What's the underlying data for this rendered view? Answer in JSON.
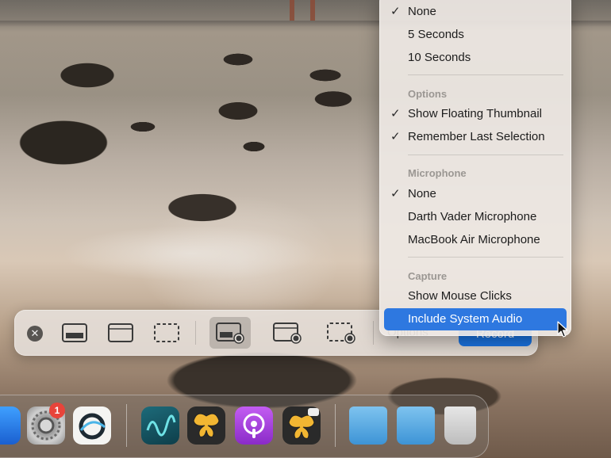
{
  "menu": {
    "timer_items": [
      {
        "label": "None",
        "checked": true
      },
      {
        "label": "5 Seconds",
        "checked": false
      },
      {
        "label": "10 Seconds",
        "checked": false
      }
    ],
    "options_header": "Options",
    "options_items": [
      {
        "label": "Show Floating Thumbnail",
        "checked": true
      },
      {
        "label": "Remember Last Selection",
        "checked": true
      }
    ],
    "microphone_header": "Microphone",
    "microphone_items": [
      {
        "label": "None",
        "checked": true
      },
      {
        "label": "Darth Vader Microphone",
        "checked": false
      },
      {
        "label": "MacBook Air Microphone",
        "checked": false
      }
    ],
    "capture_header": "Capture",
    "capture_items": [
      {
        "label": "Show Mouse Clicks",
        "checked": false
      },
      {
        "label": "Include System Audio",
        "checked": false,
        "highlighted": true
      }
    ],
    "check_glyph": "✓"
  },
  "toolbar": {
    "close_glyph": "✕",
    "options_label": "Options",
    "record_label": "Record",
    "selected_tool": "record-entire-screen"
  },
  "dock": {
    "settings_badge": "1"
  },
  "colors": {
    "accent": "#2e78e0",
    "record_button": "#1a74e2",
    "badge": "#e8443a"
  }
}
